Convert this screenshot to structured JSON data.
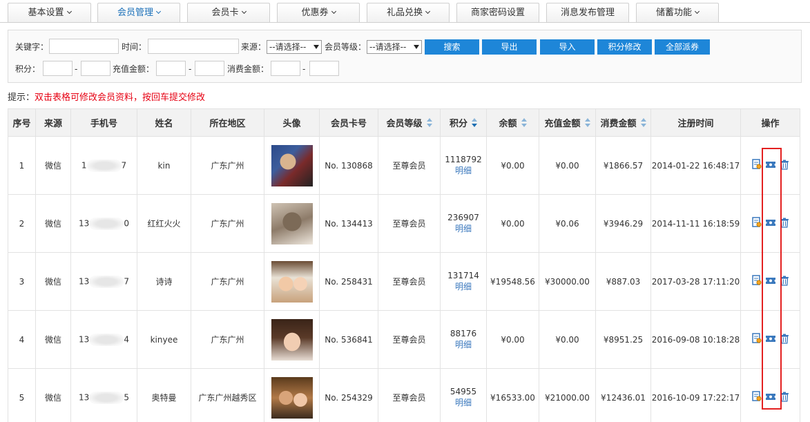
{
  "nav": {
    "tabs": [
      {
        "label": "基本设置",
        "dropdown": true,
        "active": false
      },
      {
        "label": "会员管理",
        "dropdown": true,
        "active": true
      },
      {
        "label": "会员卡",
        "dropdown": true,
        "active": false
      },
      {
        "label": "优惠券",
        "dropdown": true,
        "active": false
      },
      {
        "label": "礼品兑换",
        "dropdown": true,
        "active": false
      },
      {
        "label": "商家密码设置",
        "dropdown": false,
        "active": false
      },
      {
        "label": "消息发布管理",
        "dropdown": false,
        "active": false
      },
      {
        "label": "储蓄功能",
        "dropdown": true,
        "active": false
      }
    ]
  },
  "search": {
    "keyword_label": "关键字：",
    "time_label": "时间：",
    "source_label": "来源：",
    "source_value": "--请选择--",
    "level_label": "会员等级：",
    "level_value": "--请选择--",
    "points_label": "积分：",
    "recharge_label": "充值金额：",
    "spend_label": "消费金额：",
    "dash": "-",
    "buttons": {
      "search": "搜索",
      "export": "导出",
      "import": "导入",
      "points_edit": "积分修改",
      "all_coupon": "全部派券"
    }
  },
  "tip": {
    "prefix": "提示：",
    "text": "双击表格可修改会员资料，按回车提交修改"
  },
  "table": {
    "headers": [
      "序号",
      "来源",
      "手机号",
      "姓名",
      "所在地区",
      "头像",
      "会员卡号",
      "会员等级",
      "积分",
      "余额",
      "充值金额",
      "消费金额",
      "注册时间",
      "操作"
    ],
    "detail_label": "明细",
    "rows": [
      {
        "no": "1",
        "source": "微信",
        "phone_start": "1",
        "phone_end": "7",
        "name": "kin",
        "region": "广东广州",
        "card": "No. 130868",
        "level": "至尊会员",
        "points": "1118792",
        "balance": "¥0.00",
        "recharge": "¥0.00",
        "spend": "¥1866.57",
        "reg_time": "2014-01-22 16:48:17"
      },
      {
        "no": "2",
        "source": "微信",
        "phone_start": "13",
        "phone_end": "0",
        "name": "红红火火",
        "region": "广东广州",
        "card": "No. 134413",
        "level": "至尊会员",
        "points": "236907",
        "balance": "¥0.00",
        "recharge": "¥0.06",
        "spend": "¥3946.29",
        "reg_time": "2014-11-11 16:18:59"
      },
      {
        "no": "3",
        "source": "微信",
        "phone_start": "13",
        "phone_end": "7",
        "name": "诗诗",
        "region": "广东广州",
        "card": "No. 258431",
        "level": "至尊会员",
        "points": "131714",
        "balance": "¥19548.56",
        "recharge": "¥30000.00",
        "spend": "¥887.03",
        "reg_time": "2017-03-28 17:11:20"
      },
      {
        "no": "4",
        "source": "微信",
        "phone_start": "13",
        "phone_end": "4",
        "name": "kinyee",
        "region": "广东广州",
        "card": "No. 536841",
        "level": "至尊会员",
        "points": "88176",
        "balance": "¥0.00",
        "recharge": "¥0.00",
        "spend": "¥8951.25",
        "reg_time": "2016-09-08 10:18:28"
      },
      {
        "no": "5",
        "source": "微信",
        "phone_start": "13",
        "phone_end": "5",
        "name": "奥特曼",
        "region": "广东广州越秀区",
        "card": "No. 254329",
        "level": "至尊会员",
        "points": "54955",
        "balance": "¥16533.00",
        "recharge": "¥21000.00",
        "spend": "¥12436.01",
        "reg_time": "2016-10-09 17:22:17"
      }
    ],
    "sortable_columns": [
      "会员等级",
      "积分",
      "余额",
      "充值金额",
      "消费金额"
    ],
    "row_actions": [
      "view-detail-icon",
      "coupon-icon",
      "trash-icon"
    ]
  },
  "colors": {
    "accent": "#1e86d8",
    "tip_red": "#e60012",
    "link_blue": "#3a78bd",
    "highlight_red": "#e32020"
  }
}
